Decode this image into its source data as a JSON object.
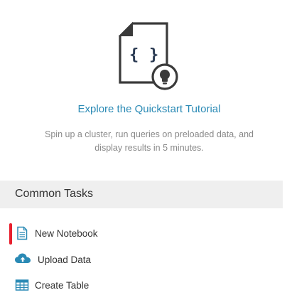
{
  "quickstart": {
    "link_text": "Explore the Quickstart Tutorial",
    "description": "Spin up a cluster, run queries on preloaded data, and display results in 5 minutes.",
    "icon": "notebook-lightbulb-icon"
  },
  "common_tasks": {
    "title": "Common Tasks",
    "items": [
      {
        "label": "New Notebook",
        "icon": "notebook-icon",
        "active": true
      },
      {
        "label": "Upload Data",
        "icon": "cloud-upload-icon",
        "active": false
      },
      {
        "label": "Create Table",
        "icon": "table-icon",
        "active": false
      }
    ]
  },
  "colors": {
    "link": "#2a8ab5",
    "icon_blue": "#2a8ab5",
    "accent_red": "#e8202e",
    "header_bg": "#efefef",
    "muted_text": "#8a8a8a"
  }
}
